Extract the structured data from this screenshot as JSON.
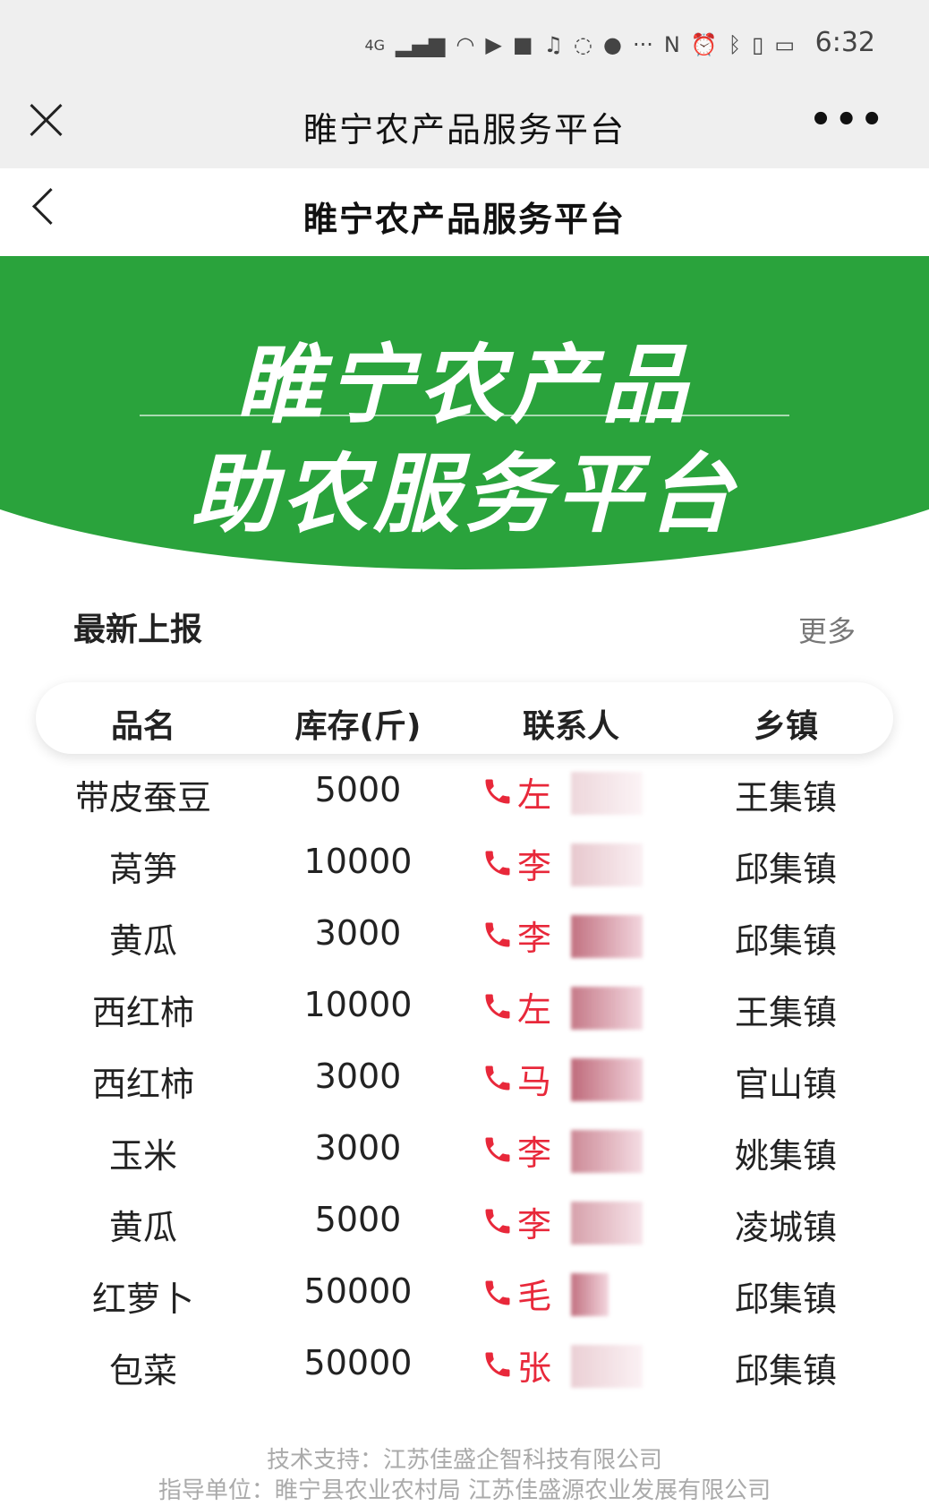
{
  "status_bar": {
    "network": "4G",
    "time": "6:32"
  },
  "wechat_header": {
    "title": "睢宁农产品服务平台",
    "more_label": "•••"
  },
  "page_nav": {
    "title": "睢宁农产品服务平台"
  },
  "banner": {
    "line1": "睢宁农产品",
    "line2": "助农服务平台",
    "color": "#2aa33c"
  },
  "section": {
    "title": "最新上报",
    "more_label": "更多"
  },
  "table": {
    "headers": [
      "品名",
      "库存(斤)",
      "联系人",
      "乡镇"
    ],
    "rows": [
      {
        "name": "带皮蚕豆",
        "stock": "5000",
        "contact": "左",
        "town": "王集镇"
      },
      {
        "name": "莴笋",
        "stock": "10000",
        "contact": "李",
        "town": "邱集镇"
      },
      {
        "name": "黄瓜",
        "stock": "3000",
        "contact": "李",
        "town": "邱集镇"
      },
      {
        "name": "西红柿",
        "stock": "10000",
        "contact": "左",
        "town": "王集镇"
      },
      {
        "name": "西红柿",
        "stock": "3000",
        "contact": "马",
        "town": "官山镇"
      },
      {
        "name": "玉米",
        "stock": "3000",
        "contact": "李",
        "town": "姚集镇"
      },
      {
        "name": "黄瓜",
        "stock": "5000",
        "contact": "李",
        "town": "凌城镇"
      },
      {
        "name": "红萝卜",
        "stock": "50000",
        "contact": "毛",
        "town": "邱集镇"
      },
      {
        "name": "包菜",
        "stock": "50000",
        "contact": "张",
        "town": "邱集镇"
      }
    ],
    "contact_color": "#e8283a"
  },
  "footer": {
    "tech_support": "技术支持：江苏佳盛企智科技有限公司",
    "guidance": "指导单位：睢宁县农业农村局 江苏佳盛源农业发展有限公司"
  }
}
